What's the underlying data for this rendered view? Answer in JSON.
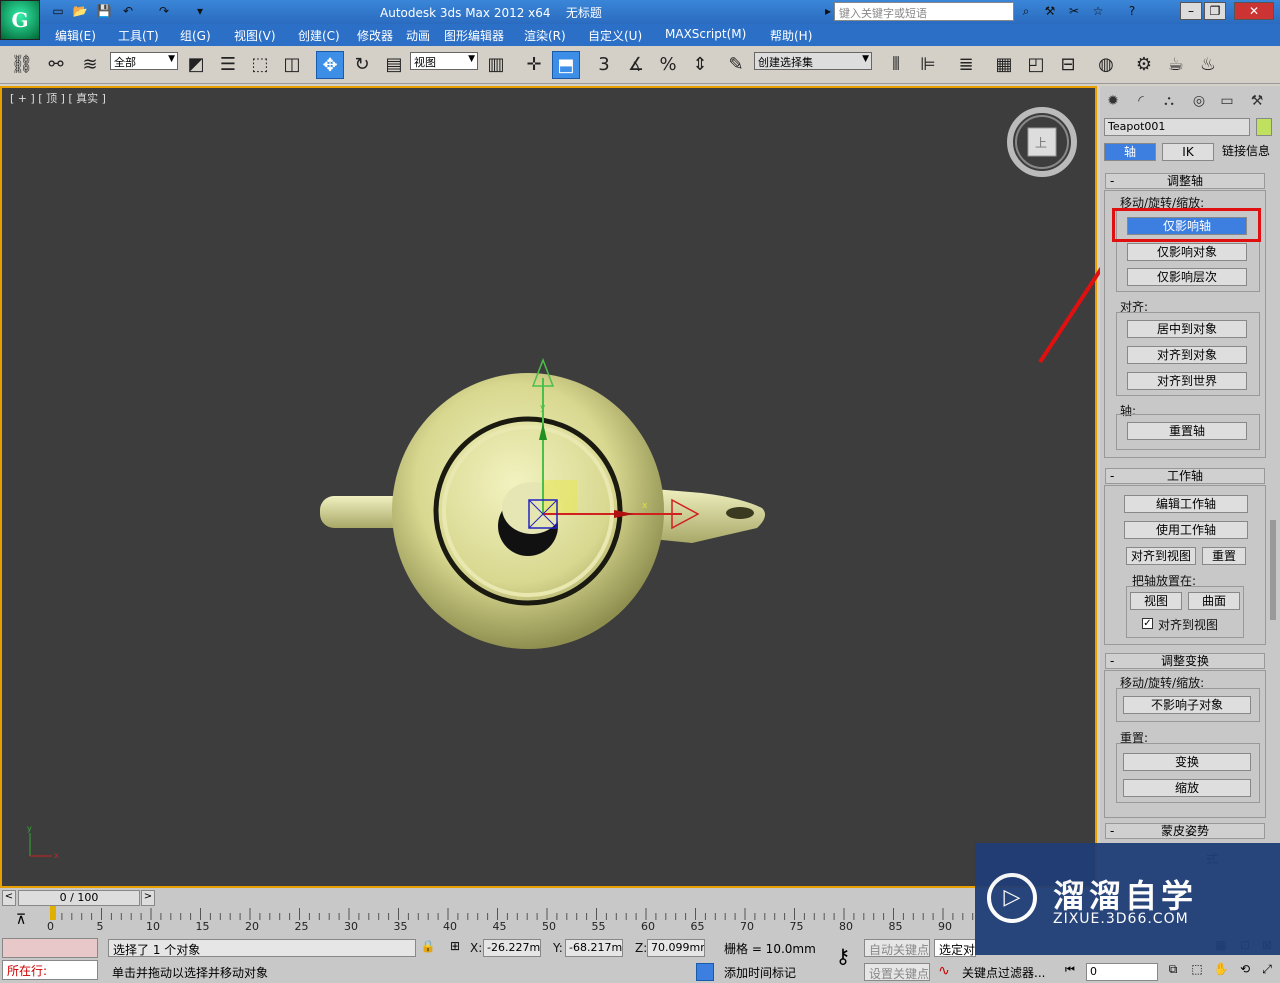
{
  "window": {
    "title": "Autodesk 3ds Max  2012 x64",
    "doc_title": "无标题",
    "search_placeholder": "键入关键字或短语"
  },
  "menu": [
    "编辑(E)",
    "工具(T)",
    "组(G)",
    "视图(V)",
    "创建(C)",
    "修改器",
    "动画",
    "图形编辑器",
    "渲染(R)",
    "自定义(U)",
    "MAXScript(M)",
    "帮助(H)"
  ],
  "toolbar": {
    "selection_filter": "全部",
    "ref_coord": "视图",
    "named_selection": "创建选择集",
    "snap_3": "3",
    "percent": "%"
  },
  "viewport": {
    "label": "[ + ] [ 顶 ] [ 真实 ]",
    "viewcube_label": "上",
    "gizmo_x": "x",
    "gizmo_y": "y",
    "axis_y": "y",
    "axis_x": "x"
  },
  "panel": {
    "object_name": "Teapot001",
    "tabs": [
      "轴",
      "IK",
      "链接信息"
    ],
    "adjust_pivot": {
      "header": "调整轴",
      "group1": "移动/旋转/缩放:",
      "btn_pivot_only": "仅影响轴",
      "btn_object_only": "仅影响对象",
      "btn_hierarchy_only": "仅影响层次",
      "group2": "对齐:",
      "btn_center": "居中到对象",
      "btn_align_obj": "对齐到对象",
      "btn_align_world": "对齐到世界",
      "group3": "轴:",
      "btn_reset": "重置轴"
    },
    "working_pivot": {
      "header": "工作轴",
      "btn_edit": "编辑工作轴",
      "btn_use": "使用工作轴",
      "btn_align_view": "对齐到视图",
      "btn_reset": "重置",
      "group_place": "把轴放置在:",
      "btn_view": "视图",
      "btn_surface": "曲面",
      "chk_align_view": "对齐到视图"
    },
    "adjust_transform": {
      "header": "调整变换",
      "group1": "移动/旋转/缩放:",
      "btn_no_children": "不影响子对象",
      "group2": "重置:",
      "btn_transform": "变换",
      "btn_scale": "缩放"
    },
    "skin_pose": {
      "header": "蒙皮姿势",
      "partial": "式"
    }
  },
  "timeline": {
    "frame": "0 / 100",
    "ticks": [
      "0",
      "5",
      "10",
      "15",
      "20",
      "25",
      "30",
      "35",
      "40",
      "45",
      "50",
      "55",
      "60",
      "65",
      "70",
      "75",
      "80",
      "85",
      "90"
    ]
  },
  "status": {
    "selected": "选择了 1 个对象",
    "hint": "单击并拖动以选择并移动对象",
    "running": "所在行:",
    "x_label": "X:",
    "x": "-26.227mm",
    "y_label": "Y:",
    "y": "-68.217mm",
    "z_label": "Z:",
    "z": "70.099mm",
    "grid": "栅格 = 10.0mm",
    "add_time_tag": "添加时间标记",
    "auto_key": "自动关键点",
    "set_key": "设置关键点",
    "selected_obj": "选定对",
    "key_filter": "关键点过滤器...",
    "frame_field": "0"
  },
  "watermark": {
    "title": "溜溜自学",
    "url": "ZIXUE.3D66.COM"
  },
  "colors": {
    "highlight": "#e01010",
    "viewport_bg": "#3d3d3d",
    "selected_button": "#3d7fe0"
  }
}
